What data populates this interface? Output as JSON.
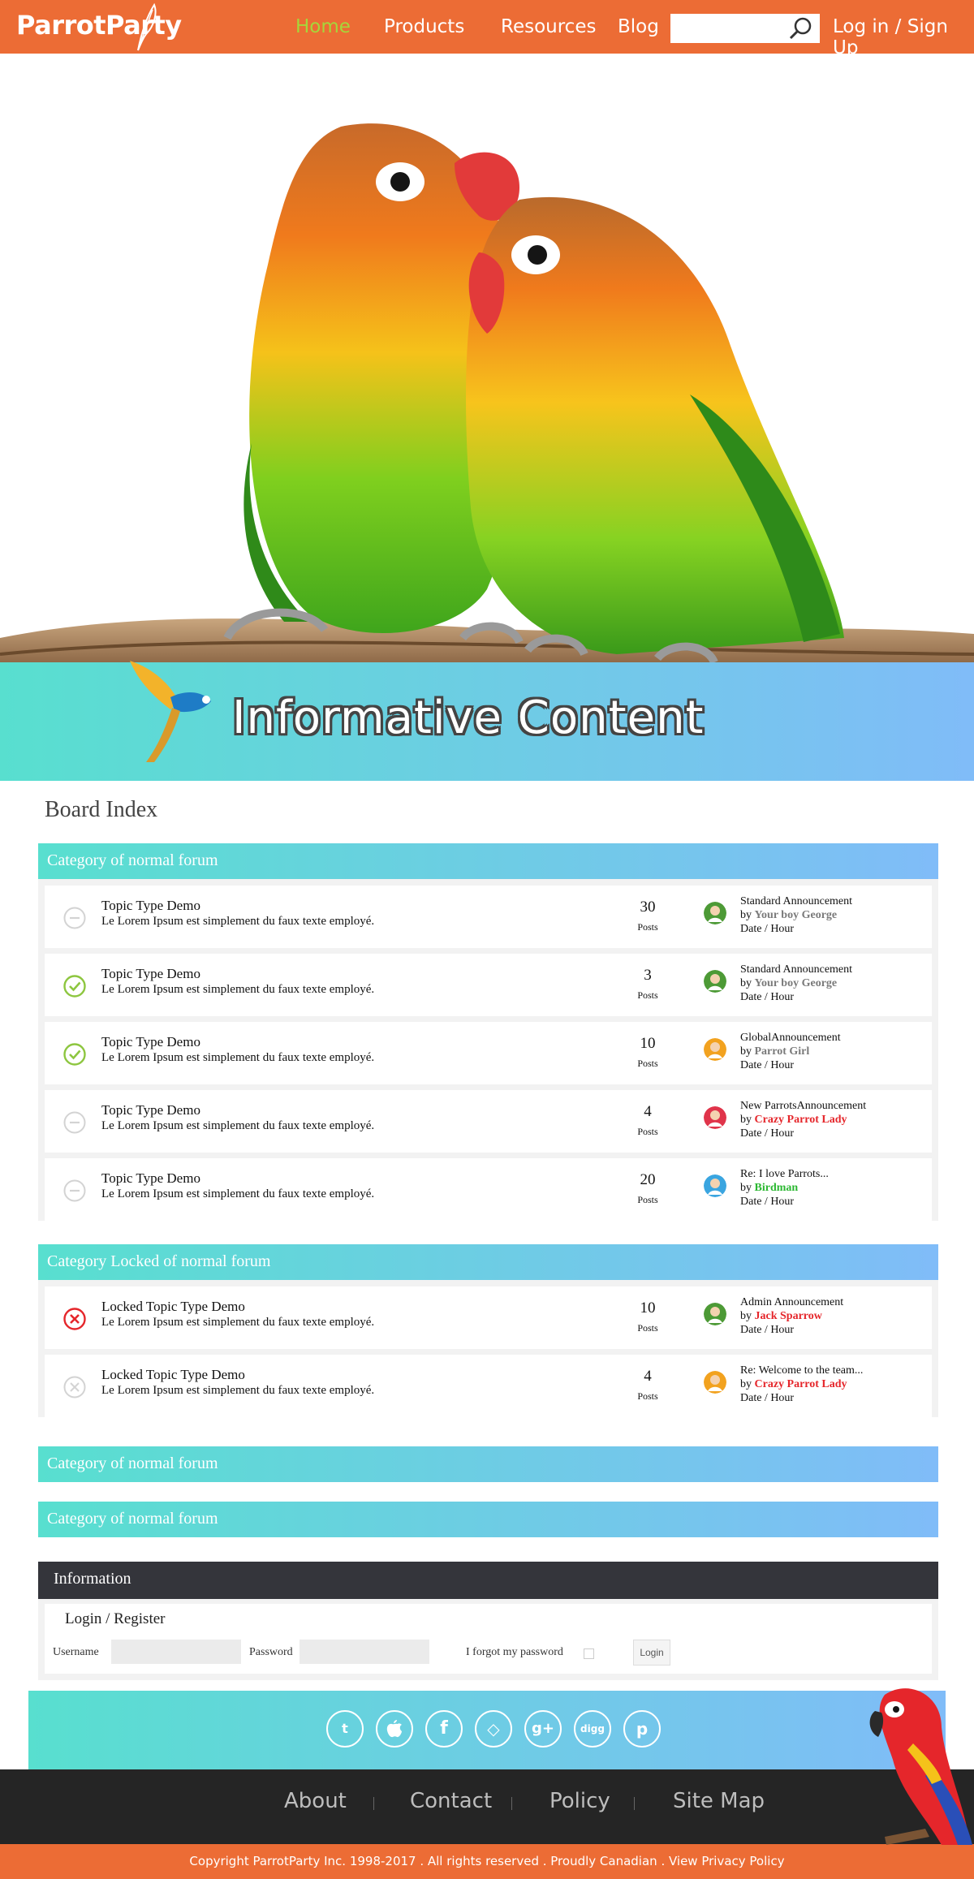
{
  "header": {
    "logo": "ParrotParty",
    "nav": [
      {
        "label": "Home",
        "active": true
      },
      {
        "label": "Products",
        "active": false
      },
      {
        "label": "Resources",
        "active": false
      },
      {
        "label": "Blog",
        "active": false
      }
    ],
    "search": {
      "value": "",
      "placeholder": ""
    },
    "login_label": "Log in / Sign Up"
  },
  "banner": {
    "title": "Informative Content"
  },
  "board": {
    "title": "Board Index",
    "categories": [
      {
        "name": "Category of normal forum",
        "rows": [
          {
            "status": "read",
            "title": "Topic Type Demo",
            "desc": "Le Lorem Ipsum est simplement du faux texte employé.",
            "posts": "30",
            "posts_label": "Posts",
            "last_title": "Standard Announcement",
            "by": "by",
            "last_user": "Your boy George",
            "user_color": "#7a7a7a",
            "avatar": "green",
            "date": "Date / Hour"
          },
          {
            "status": "new",
            "title": "Topic Type Demo",
            "desc": "Le Lorem Ipsum est simplement du faux texte employé.",
            "posts": "3",
            "posts_label": "Posts",
            "last_title": "Standard Announcement",
            "by": "by",
            "last_user": "Your boy George",
            "user_color": "#7a7a7a",
            "avatar": "green",
            "date": "Date / Hour"
          },
          {
            "status": "new",
            "title": "Topic Type Demo",
            "desc": "Le Lorem Ipsum est simplement du faux texte employé.",
            "posts": "10",
            "posts_label": "Posts",
            "last_title": "GlobalAnnouncement",
            "by": "by",
            "last_user": "Parrot Girl",
            "user_color": "#7a7a7a",
            "avatar": "orange",
            "date": "Date / Hour"
          },
          {
            "status": "read",
            "title": "Topic Type Demo",
            "desc": "Le Lorem Ipsum est simplement du faux texte employé.",
            "posts": "4",
            "posts_label": "Posts",
            "last_title": "New ParrotsAnnouncement",
            "by": "by",
            "last_user": "Crazy Parrot Lady",
            "user_color": "#e5262b",
            "avatar": "red",
            "date": "Date / Hour"
          },
          {
            "status": "read",
            "title": "Topic Type Demo",
            "desc": "Le Lorem Ipsum est simplement du faux texte employé.",
            "posts": "20",
            "posts_label": "Posts",
            "last_title": "Re: I love Parrots...",
            "by": "by",
            "last_user": "Birdman",
            "user_color": "#2cb832",
            "avatar": "blue",
            "date": "Date / Hour"
          }
        ]
      },
      {
        "name": "Category Locked of normal forum",
        "rows": [
          {
            "status": "locked",
            "title": "Locked Topic Type Demo",
            "desc": "Le Lorem Ipsum est simplement du faux texte employé.",
            "posts": "10",
            "posts_label": "Posts",
            "last_title": "Admin Announcement",
            "by": "by",
            "last_user": "Jack Sparrow",
            "user_color": "#e5262b",
            "avatar": "green",
            "date": "Date / Hour"
          },
          {
            "status": "locked-read",
            "title": "Locked Topic Type Demo",
            "desc": "Le Lorem Ipsum est simplement du faux texte employé.",
            "posts": "4",
            "posts_label": "Posts",
            "last_title": "Re: Welcome to the team...",
            "by": "by",
            "last_user": "Crazy Parrot Lady",
            "user_color": "#e5262b",
            "avatar": "orange",
            "date": "Date / Hour"
          }
        ]
      },
      {
        "name": "Category of normal forum",
        "rows": []
      },
      {
        "name": "Category of normal forum",
        "rows": []
      }
    ]
  },
  "information": {
    "title": "Information",
    "subtitle": "Login / Register",
    "username_label": "Username",
    "username_value": "",
    "password_label": "Password",
    "password_value": "",
    "forgot_label": "I forgot my password",
    "login_button": "Login"
  },
  "social": [
    "twitter-icon",
    "apple-icon",
    "facebook-icon",
    "codepen-icon",
    "google-plus-icon",
    "digg-icon",
    "pinterest-icon"
  ],
  "social_glyphs": [
    "t",
    "",
    "f",
    "◇",
    "g+",
    "digg",
    "p"
  ],
  "footer": {
    "links": [
      "About",
      "Contact",
      "Policy",
      "Site Map"
    ],
    "copyright": "Copyright ParrotParty Inc. 1998-2017 . All rights reserved . Proudly Canadian . ",
    "privacy": "View Privacy Policy"
  },
  "colors": {
    "brand_orange": "#ec6c35",
    "nav_active": "#a6d63a",
    "gradient_start": "#58dfcf",
    "gradient_end": "#80bcf8",
    "info_dark": "#34353b",
    "footer_dark": "#252525"
  }
}
